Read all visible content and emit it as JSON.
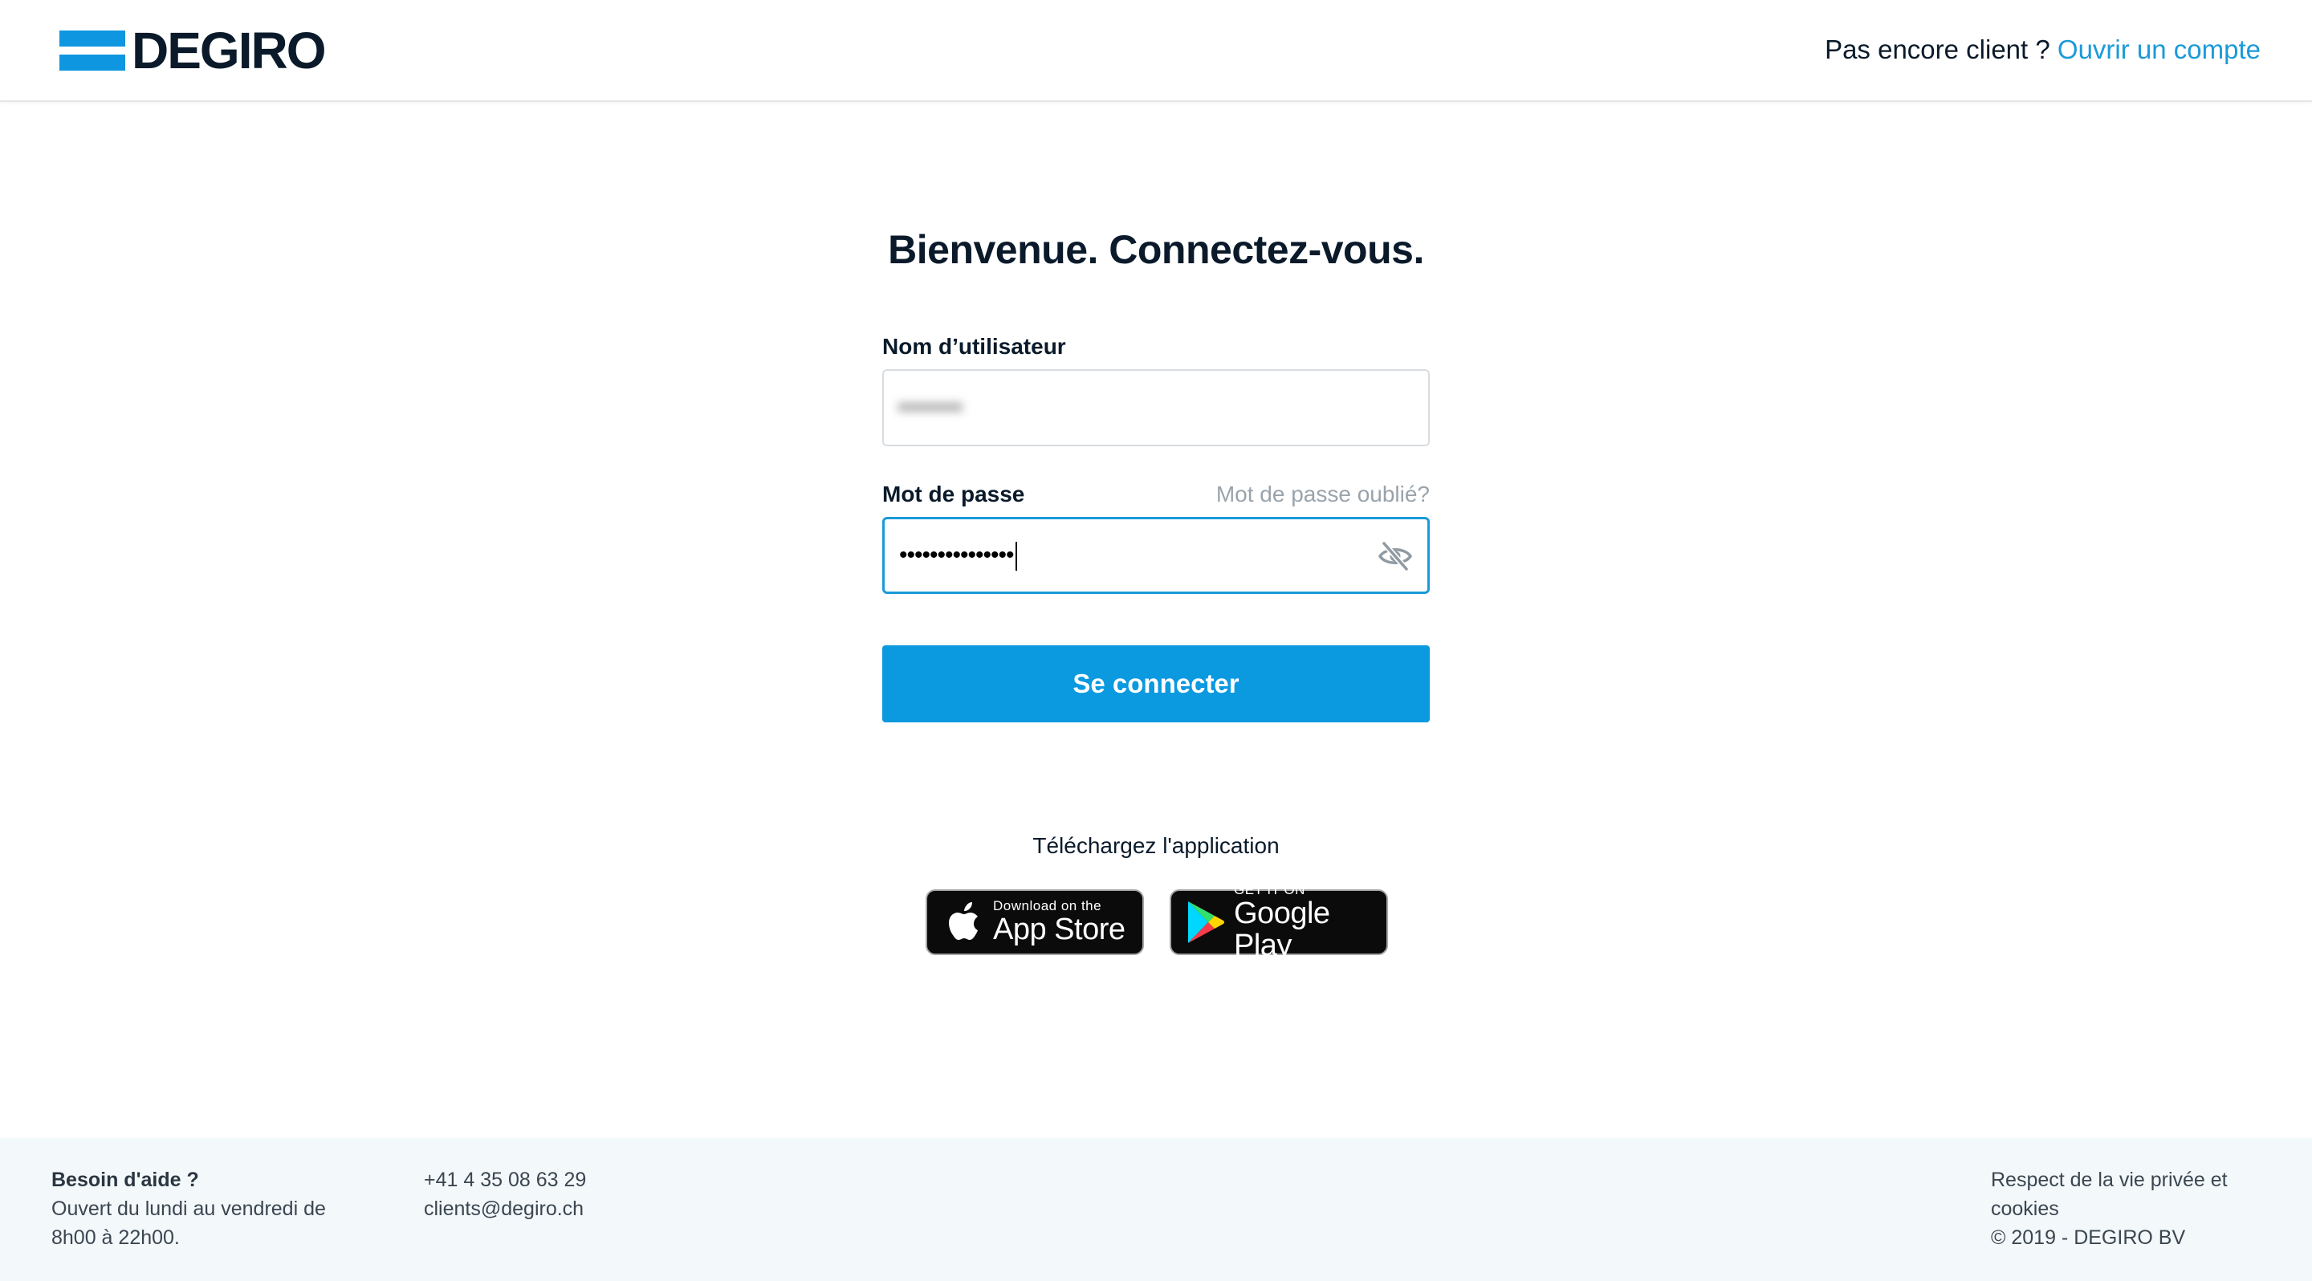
{
  "header": {
    "logo_text": "DEGIRO",
    "prompt": "Pas encore client ? ",
    "open_account_link": "Ouvrir un compte"
  },
  "login": {
    "title": "Bienvenue. Connectez-vous.",
    "username_label": "Nom d’utilisateur",
    "username_value": "•••••••",
    "password_label": "Mot de passe",
    "forgot_link": "Mot de passe oublié?",
    "password_value": "•••••••••••••••",
    "submit_label": "Se connecter"
  },
  "app_download": {
    "title": "Téléchargez l'application",
    "app_store": {
      "small": "Download on the",
      "big": "App Store"
    },
    "google_play": {
      "small": "GET IT ON",
      "big": "Google Play"
    }
  },
  "footer": {
    "help_title": "Besoin d'aide ?",
    "hours": "Ouvert du lundi au vendredi de 8h00 à 22h00.",
    "phone": "+41 4 35 08 63 29",
    "email": "clients@degiro.ch",
    "privacy_link": "Respect de la vie privée et cookies",
    "copyright": "© 2019 - DEGIRO BV"
  },
  "colors": {
    "accent": "#0b99e0",
    "link": "#1a9ad8",
    "text": "#0a1a2a",
    "footer_bg": "#f3f8fb"
  },
  "icons": [
    "degiro-logo-mark",
    "eye-slash-icon",
    "apple-icon",
    "google-play-icon"
  ]
}
